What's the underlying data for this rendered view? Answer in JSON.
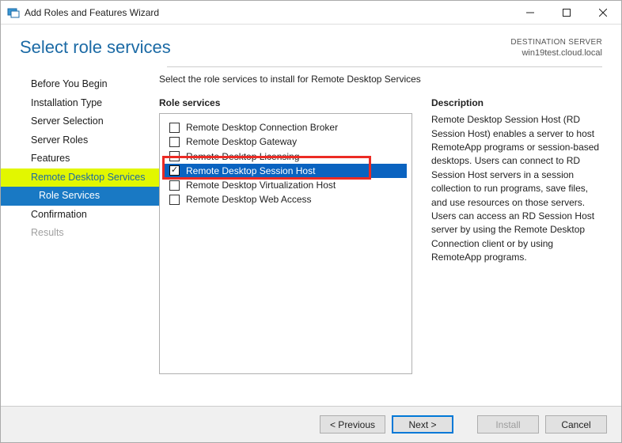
{
  "window": {
    "title": "Add Roles and Features Wizard"
  },
  "header": {
    "page_title": "Select role services",
    "destination_label": "DESTINATION SERVER",
    "destination_server": "win19test.cloud.local"
  },
  "nav": {
    "items": [
      {
        "label": "Before You Begin",
        "state": "normal"
      },
      {
        "label": "Installation Type",
        "state": "normal"
      },
      {
        "label": "Server Selection",
        "state": "normal"
      },
      {
        "label": "Server Roles",
        "state": "normal"
      },
      {
        "label": "Features",
        "state": "normal"
      },
      {
        "label": "Remote Desktop Services",
        "state": "highlighted"
      },
      {
        "label": "Role Services",
        "state": "sub-selected"
      },
      {
        "label": "Confirmation",
        "state": "normal"
      },
      {
        "label": "Results",
        "state": "disabled"
      }
    ]
  },
  "main": {
    "instruction": "Select the role services to install for Remote Desktop Services",
    "roles_heading": "Role services",
    "description_heading": "Description",
    "roles": [
      {
        "label": "Remote Desktop Connection Broker",
        "checked": false
      },
      {
        "label": "Remote Desktop Gateway",
        "checked": false
      },
      {
        "label": "Remote Desktop Licensing",
        "checked": false
      },
      {
        "label": "Remote Desktop Session Host",
        "checked": true,
        "selected": true
      },
      {
        "label": "Remote Desktop Virtualization Host",
        "checked": false
      },
      {
        "label": "Remote Desktop Web Access",
        "checked": false
      }
    ],
    "description": "Remote Desktop Session Host (RD Session Host) enables a server to host RemoteApp programs or session-based desktops. Users can connect to RD Session Host servers in a session collection to run programs, save files, and use resources on those servers. Users can access an RD Session Host server by using the Remote Desktop Connection client or by using RemoteApp programs."
  },
  "footer": {
    "previous": "< Previous",
    "next": "Next >",
    "install": "Install",
    "cancel": "Cancel"
  }
}
